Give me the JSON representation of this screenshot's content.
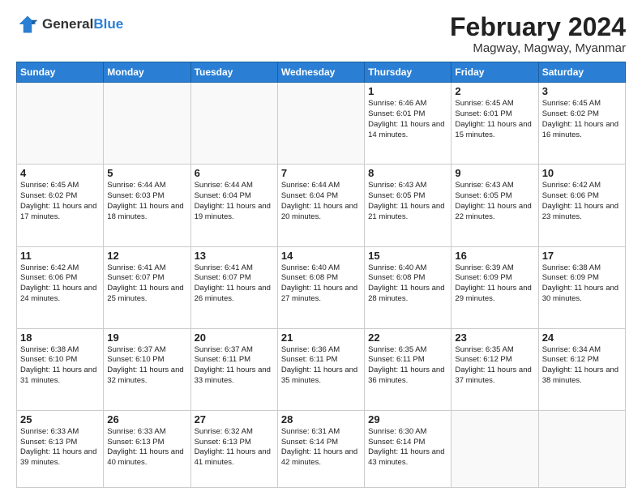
{
  "header": {
    "logo_general": "General",
    "logo_blue": "Blue",
    "month_year": "February 2024",
    "location": "Magway, Magway, Myanmar"
  },
  "weekdays": [
    "Sunday",
    "Monday",
    "Tuesday",
    "Wednesday",
    "Thursday",
    "Friday",
    "Saturday"
  ],
  "weeks": [
    [
      {
        "day": "",
        "info": ""
      },
      {
        "day": "",
        "info": ""
      },
      {
        "day": "",
        "info": ""
      },
      {
        "day": "",
        "info": ""
      },
      {
        "day": "1",
        "info": "Sunrise: 6:46 AM\nSunset: 6:01 PM\nDaylight: 11 hours and 14 minutes."
      },
      {
        "day": "2",
        "info": "Sunrise: 6:45 AM\nSunset: 6:01 PM\nDaylight: 11 hours and 15 minutes."
      },
      {
        "day": "3",
        "info": "Sunrise: 6:45 AM\nSunset: 6:02 PM\nDaylight: 11 hours and 16 minutes."
      }
    ],
    [
      {
        "day": "4",
        "info": "Sunrise: 6:45 AM\nSunset: 6:02 PM\nDaylight: 11 hours and 17 minutes."
      },
      {
        "day": "5",
        "info": "Sunrise: 6:44 AM\nSunset: 6:03 PM\nDaylight: 11 hours and 18 minutes."
      },
      {
        "day": "6",
        "info": "Sunrise: 6:44 AM\nSunset: 6:04 PM\nDaylight: 11 hours and 19 minutes."
      },
      {
        "day": "7",
        "info": "Sunrise: 6:44 AM\nSunset: 6:04 PM\nDaylight: 11 hours and 20 minutes."
      },
      {
        "day": "8",
        "info": "Sunrise: 6:43 AM\nSunset: 6:05 PM\nDaylight: 11 hours and 21 minutes."
      },
      {
        "day": "9",
        "info": "Sunrise: 6:43 AM\nSunset: 6:05 PM\nDaylight: 11 hours and 22 minutes."
      },
      {
        "day": "10",
        "info": "Sunrise: 6:42 AM\nSunset: 6:06 PM\nDaylight: 11 hours and 23 minutes."
      }
    ],
    [
      {
        "day": "11",
        "info": "Sunrise: 6:42 AM\nSunset: 6:06 PM\nDaylight: 11 hours and 24 minutes."
      },
      {
        "day": "12",
        "info": "Sunrise: 6:41 AM\nSunset: 6:07 PM\nDaylight: 11 hours and 25 minutes."
      },
      {
        "day": "13",
        "info": "Sunrise: 6:41 AM\nSunset: 6:07 PM\nDaylight: 11 hours and 26 minutes."
      },
      {
        "day": "14",
        "info": "Sunrise: 6:40 AM\nSunset: 6:08 PM\nDaylight: 11 hours and 27 minutes."
      },
      {
        "day": "15",
        "info": "Sunrise: 6:40 AM\nSunset: 6:08 PM\nDaylight: 11 hours and 28 minutes."
      },
      {
        "day": "16",
        "info": "Sunrise: 6:39 AM\nSunset: 6:09 PM\nDaylight: 11 hours and 29 minutes."
      },
      {
        "day": "17",
        "info": "Sunrise: 6:38 AM\nSunset: 6:09 PM\nDaylight: 11 hours and 30 minutes."
      }
    ],
    [
      {
        "day": "18",
        "info": "Sunrise: 6:38 AM\nSunset: 6:10 PM\nDaylight: 11 hours and 31 minutes."
      },
      {
        "day": "19",
        "info": "Sunrise: 6:37 AM\nSunset: 6:10 PM\nDaylight: 11 hours and 32 minutes."
      },
      {
        "day": "20",
        "info": "Sunrise: 6:37 AM\nSunset: 6:11 PM\nDaylight: 11 hours and 33 minutes."
      },
      {
        "day": "21",
        "info": "Sunrise: 6:36 AM\nSunset: 6:11 PM\nDaylight: 11 hours and 35 minutes."
      },
      {
        "day": "22",
        "info": "Sunrise: 6:35 AM\nSunset: 6:11 PM\nDaylight: 11 hours and 36 minutes."
      },
      {
        "day": "23",
        "info": "Sunrise: 6:35 AM\nSunset: 6:12 PM\nDaylight: 11 hours and 37 minutes."
      },
      {
        "day": "24",
        "info": "Sunrise: 6:34 AM\nSunset: 6:12 PM\nDaylight: 11 hours and 38 minutes."
      }
    ],
    [
      {
        "day": "25",
        "info": "Sunrise: 6:33 AM\nSunset: 6:13 PM\nDaylight: 11 hours and 39 minutes."
      },
      {
        "day": "26",
        "info": "Sunrise: 6:33 AM\nSunset: 6:13 PM\nDaylight: 11 hours and 40 minutes."
      },
      {
        "day": "27",
        "info": "Sunrise: 6:32 AM\nSunset: 6:13 PM\nDaylight: 11 hours and 41 minutes."
      },
      {
        "day": "28",
        "info": "Sunrise: 6:31 AM\nSunset: 6:14 PM\nDaylight: 11 hours and 42 minutes."
      },
      {
        "day": "29",
        "info": "Sunrise: 6:30 AM\nSunset: 6:14 PM\nDaylight: 11 hours and 43 minutes."
      },
      {
        "day": "",
        "info": ""
      },
      {
        "day": "",
        "info": ""
      }
    ]
  ]
}
